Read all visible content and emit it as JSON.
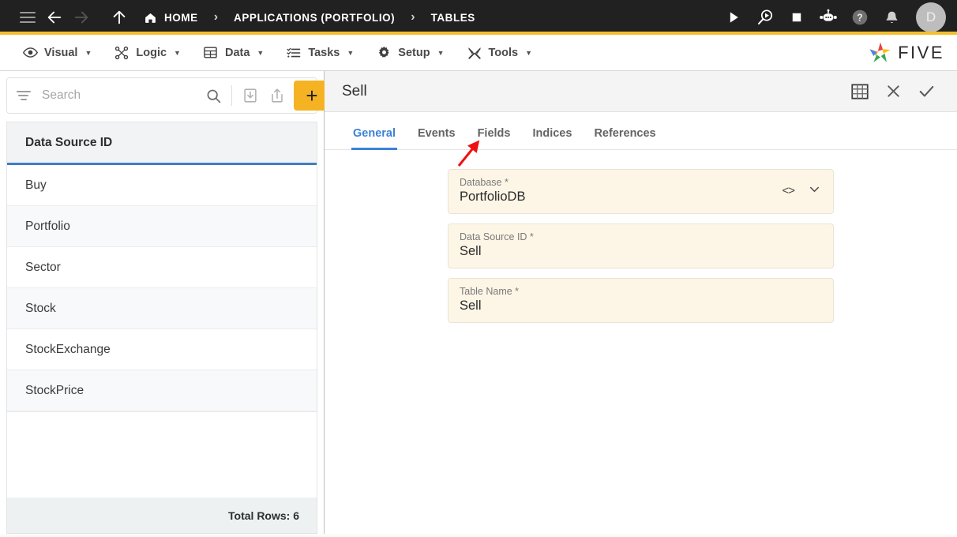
{
  "topbar": {
    "menu_icon": "hamburger-icon",
    "back_icon": "arrow-back-icon",
    "forward_icon": "arrow-forward-icon",
    "up_icon": "arrow-up-icon",
    "breadcrumbs": [
      {
        "label": "HOME",
        "icon": "home-icon"
      },
      {
        "label": "APPLICATIONS (PORTFOLIO)",
        "icon": ""
      },
      {
        "label": "TABLES",
        "icon": ""
      }
    ],
    "separator": "›",
    "actions": [
      {
        "name": "run-button",
        "icon": "play-icon"
      },
      {
        "name": "debug-button",
        "icon": "magnifier-play-icon"
      },
      {
        "name": "stop-button",
        "icon": "stop-square-icon"
      },
      {
        "name": "chatbot-button",
        "icon": "robot-icon"
      },
      {
        "name": "help-button",
        "icon": "question-circle-icon"
      },
      {
        "name": "notifications-button",
        "icon": "bell-icon"
      }
    ],
    "avatar_initial": "D"
  },
  "menubar": {
    "items": [
      {
        "label": "Visual",
        "icon": "eye-icon"
      },
      {
        "label": "Logic",
        "icon": "nodes-icon"
      },
      {
        "label": "Data",
        "icon": "table-grid-icon"
      },
      {
        "label": "Tasks",
        "icon": "checklist-icon"
      },
      {
        "label": "Setup",
        "icon": "gear-icon"
      },
      {
        "label": "Tools",
        "icon": "tools-icon"
      }
    ],
    "caret": "▼",
    "logo_text": "FIVE"
  },
  "sidebar": {
    "search": {
      "placeholder": "Search",
      "value": ""
    },
    "filter_icon": "filter-icon",
    "search_icon": "search-icon",
    "import_icon": "import-download-icon",
    "export_icon": "export-share-icon",
    "add_label": "+",
    "column_header": "Data Source ID",
    "rows": [
      {
        "label": "Buy"
      },
      {
        "label": "Portfolio"
      },
      {
        "label": "Sector"
      },
      {
        "label": "Stock"
      },
      {
        "label": "StockExchange"
      },
      {
        "label": "StockPrice"
      }
    ],
    "footer": "Total Rows: 6"
  },
  "panel": {
    "title": "Sell",
    "header_actions": [
      {
        "name": "grid-view-button",
        "icon": "table-grid-icon"
      },
      {
        "name": "close-button",
        "icon": "close-x-icon"
      },
      {
        "name": "save-button",
        "icon": "check-icon"
      }
    ],
    "tabs": [
      {
        "label": "General",
        "active": true
      },
      {
        "label": "Events",
        "active": false
      },
      {
        "label": "Fields",
        "active": false
      },
      {
        "label": "Indices",
        "active": false
      },
      {
        "label": "References",
        "active": false
      }
    ],
    "fields": [
      {
        "label": "Database *",
        "value": "PortfolioDB",
        "code_icon": "<>",
        "dropdown_icon": "chevron-down-icon"
      },
      {
        "label": "Data Source ID *",
        "value": "Sell"
      },
      {
        "label": "Table Name *",
        "value": "Sell"
      }
    ]
  },
  "annotation": {
    "color": "#ee1111",
    "target": "Fields"
  },
  "colors": {
    "accent_orange": "#F5BE2C",
    "accent_blue": "#3B82D6",
    "topbar_bg": "#212121",
    "field_bg": "#FDF5E6"
  }
}
